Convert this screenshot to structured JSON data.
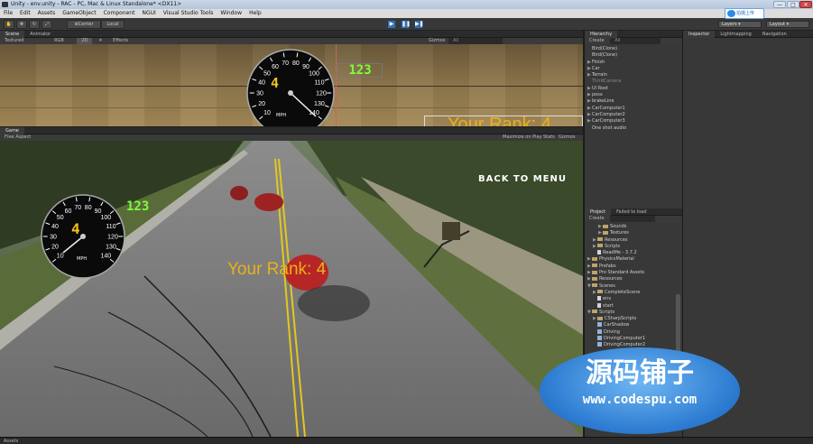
{
  "window": {
    "title": "Unity - env.unity - RAC - PC, Mac & Linux Standalone* <DX11>",
    "minimize": "—",
    "maximize": "□",
    "close": "✕"
  },
  "menu": [
    "File",
    "Edit",
    "Assets",
    "GameObject",
    "Component",
    "NGUI",
    "Visual Studio Tools",
    "Window",
    "Help"
  ],
  "toolbar": {
    "center": "Center",
    "local": "Local",
    "layers": "Layers",
    "layout": "Layout",
    "ime_label": "拍摄上传"
  },
  "scene_panel": {
    "tabs": [
      "Scene",
      "Animator"
    ],
    "shading": "Textured",
    "render": "RGB",
    "mode_2d": "2D",
    "effects": "Effects",
    "gizmos": "Gizmos",
    "search": "All"
  },
  "game_panel": {
    "tab": "Game",
    "aspect": "Free Aspect",
    "maximize": "Maximize on Play",
    "stats": "Stats",
    "gizmos": "Gizmos"
  },
  "hud": {
    "gear": "4",
    "speed_digits": "123",
    "unit": "MPH",
    "rank_text": "Your Rank: 4",
    "back_to_menu": "BACK TO MENU",
    "gauge_labels": [
      "10",
      "20",
      "30",
      "40",
      "50",
      "60",
      "70",
      "80",
      "90",
      "100",
      "110",
      "120",
      "130",
      "140"
    ]
  },
  "hierarchy": {
    "tab": "Hierarchy",
    "create": "Create",
    "search": "All",
    "items": [
      {
        "label": "Bird(Clone)",
        "arrow": "",
        "dim": false
      },
      {
        "label": "Bird(Clone)",
        "arrow": "",
        "dim": false
      },
      {
        "label": "Finish",
        "arrow": "▶",
        "dim": false
      },
      {
        "label": "Car",
        "arrow": "▶",
        "dim": false
      },
      {
        "label": "Terrain",
        "arrow": "▶",
        "dim": false
      },
      {
        "label": "ThirdCamera",
        "arrow": "",
        "dim": true
      },
      {
        "label": "UI Root",
        "arrow": "▶",
        "dim": false
      },
      {
        "label": "posx",
        "arrow": "▶",
        "dim": false
      },
      {
        "label": "brakeLine",
        "arrow": "▶",
        "dim": false
      },
      {
        "label": "CarComputer1",
        "arrow": "▶",
        "dim": false
      },
      {
        "label": "CarComputer2",
        "arrow": "▶",
        "dim": false
      },
      {
        "label": "CarComputer3",
        "arrow": "▶",
        "dim": false
      },
      {
        "label": "One shot audio",
        "arrow": "",
        "dim": false
      }
    ]
  },
  "project": {
    "tabs": [
      "Project",
      "Failed to load"
    ],
    "create": "Create",
    "items": [
      {
        "label": "Sounds",
        "indent": 2,
        "kind": "folder",
        "arrow": "▶"
      },
      {
        "label": "Textures",
        "indent": 2,
        "kind": "folder",
        "arrow": "▶"
      },
      {
        "label": "Resources",
        "indent": 1,
        "kind": "folder",
        "arrow": "▶"
      },
      {
        "label": "Scripts",
        "indent": 1,
        "kind": "folder",
        "arrow": "▶"
      },
      {
        "label": "ReadMe - 3.7.2",
        "indent": 1,
        "kind": "file",
        "arrow": ""
      },
      {
        "label": "PhysicsMaterial",
        "indent": 0,
        "kind": "folder",
        "arrow": "▶"
      },
      {
        "label": "Prefabs",
        "indent": 0,
        "kind": "folder",
        "arrow": "▶"
      },
      {
        "label": "Pro Standard Assets",
        "indent": 0,
        "kind": "folder",
        "arrow": "▶"
      },
      {
        "label": "Resources",
        "indent": 0,
        "kind": "folder",
        "arrow": "▶"
      },
      {
        "label": "Scenes",
        "indent": 0,
        "kind": "folder",
        "arrow": "▼"
      },
      {
        "label": "CompleteScene",
        "indent": 1,
        "kind": "folder",
        "arrow": "▶"
      },
      {
        "label": "env",
        "indent": 1,
        "kind": "file",
        "arrow": ""
      },
      {
        "label": "start",
        "indent": 1,
        "kind": "file",
        "arrow": ""
      },
      {
        "label": "Scripts",
        "indent": 0,
        "kind": "folder",
        "arrow": "▼"
      },
      {
        "label": "CSharpScripts",
        "indent": 1,
        "kind": "folder",
        "arrow": "▶"
      },
      {
        "label": "CarShadow",
        "indent": 1,
        "kind": "script",
        "arrow": ""
      },
      {
        "label": "Driving",
        "indent": 1,
        "kind": "script",
        "arrow": ""
      },
      {
        "label": "DrivingComputer1",
        "indent": 1,
        "kind": "script",
        "arrow": ""
      },
      {
        "label": "DrivingComputer2",
        "indent": 1,
        "kind": "script",
        "arrow": ""
      }
    ]
  },
  "inspector": {
    "tabs": [
      "Inspector",
      "Lightmapping",
      "Navigation"
    ]
  },
  "status": {
    "text": "Assets"
  },
  "watermark": {
    "title": "源码铺子",
    "url": "www.codespu.com"
  }
}
